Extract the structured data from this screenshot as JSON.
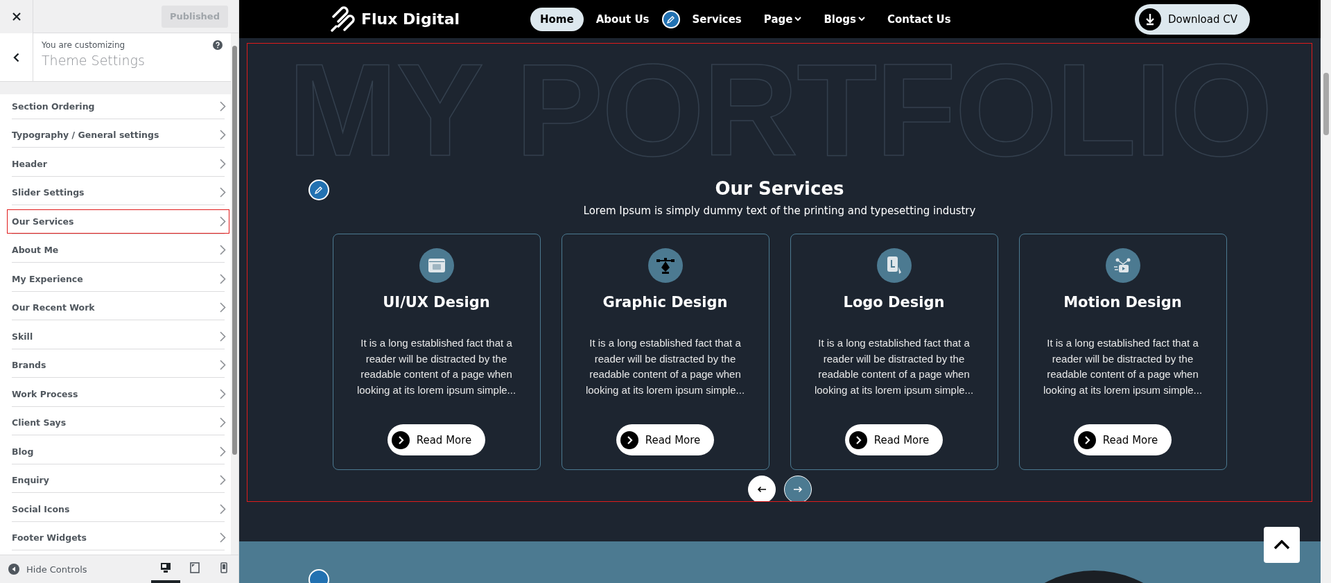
{
  "customizer": {
    "publish_button": {
      "label": "Published",
      "disabled": true
    },
    "context_label": "You are customizing",
    "context_title": "Theme Settings",
    "sections": [
      {
        "label": "Section Ordering",
        "selected": false
      },
      {
        "label": "Typography / General settings",
        "selected": false
      },
      {
        "label": "Header",
        "selected": false
      },
      {
        "label": "Slider Settings",
        "selected": false
      },
      {
        "label": "Our Services",
        "selected": true
      },
      {
        "label": "About Me",
        "selected": false
      },
      {
        "label": "My Experience",
        "selected": false
      },
      {
        "label": "Our Recent Work",
        "selected": false
      },
      {
        "label": "Skill",
        "selected": false
      },
      {
        "label": "Brands",
        "selected": false
      },
      {
        "label": "Work Process",
        "selected": false
      },
      {
        "label": "Client Says",
        "selected": false
      },
      {
        "label": "Blog",
        "selected": false
      },
      {
        "label": "Enquiry",
        "selected": false
      },
      {
        "label": "Social Icons",
        "selected": false
      },
      {
        "label": "Footer Widgets",
        "selected": false
      }
    ],
    "hide_controls": "Hide Controls",
    "devices": [
      {
        "kind": "desktop",
        "selected": true
      },
      {
        "kind": "tablet",
        "selected": false
      },
      {
        "kind": "mobile",
        "selected": false
      }
    ]
  },
  "site": {
    "logo": "Flux Digital",
    "nav": [
      {
        "label": "Home",
        "selected": true,
        "dropdown": false
      },
      {
        "label": "About Us",
        "selected": false,
        "dropdown": false
      },
      {
        "label": "Services",
        "selected": false,
        "dropdown": false
      },
      {
        "label": "Page",
        "selected": false,
        "dropdown": true
      },
      {
        "label": "Blogs",
        "selected": false,
        "dropdown": true
      },
      {
        "label": "Contact Us",
        "selected": false,
        "dropdown": false
      }
    ],
    "cta": "Download CV",
    "watermark": "MY PORTFOLIO",
    "services": {
      "title": "Our Services",
      "subtitle": "Lorem Ipsum is simply dummy text of the printing and typesetting industry",
      "cards": [
        {
          "kind": "uiux",
          "title": "UI/UX Design",
          "text": "It is a long established fact that a reader will be distracted by the readable content of a page when looking at its lorem ipsum simple...",
          "button": "Read More"
        },
        {
          "kind": "graphic",
          "title": "Graphic Design",
          "text": "It is a long established fact that a reader will be distracted by the readable content of a page when looking at its lorem ipsum simple...",
          "button": "Read More"
        },
        {
          "kind": "logo",
          "title": "Logo Design",
          "text": "It is a long established fact that a reader will be distracted by the readable content of a page when looking at its lorem ipsum simple...",
          "button": "Read More"
        },
        {
          "kind": "motion",
          "title": "Motion Design",
          "text": "It is a long established fact that a reader will be distracted by the readable content of a page when looking at its lorem ipsum simple...",
          "button": "Read More"
        }
      ]
    }
  }
}
